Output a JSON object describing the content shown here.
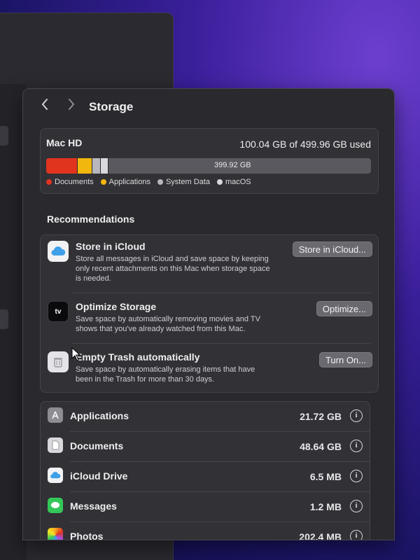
{
  "window": {
    "title": "Storage"
  },
  "disk": {
    "name": "Mac HD",
    "used_text": "100.04 GB of 499.96 GB used",
    "free_label": "399.92 GB",
    "segments": [
      {
        "name": "Documents",
        "color": "#e0341f",
        "fraction": 0.097
      },
      {
        "name": "Applications",
        "color": "#f1b70d",
        "fraction": 0.046
      },
      {
        "name": "System Data",
        "color": "#b8b7bc",
        "fraction": 0.025
      },
      {
        "name": "macOS",
        "color": "#d9d8dc",
        "fraction": 0.023
      }
    ],
    "legend": [
      "Documents",
      "Applications",
      "System Data",
      "macOS"
    ]
  },
  "recommendations": {
    "title": "Recommendations",
    "items": [
      {
        "title": "Store in iCloud",
        "desc": "Store all messages in iCloud and save space by keeping only recent attachments on this Mac when storage space is needed.",
        "button": "Store in iCloud...",
        "icon": "icloud-icon"
      },
      {
        "title": "Optimize Storage",
        "desc": "Save space by automatically removing movies and TV shows that you've already watched from this Mac.",
        "button": "Optimize...",
        "icon": "apple-tv-icon",
        "icon_text": "tv"
      },
      {
        "title": "Empty Trash automatically",
        "desc": "Save space by automatically erasing items that have been in the Trash for more than 30 days.",
        "button": "Turn On...",
        "icon": "trash-icon"
      }
    ]
  },
  "categories": [
    {
      "name": "Applications",
      "size": "21.72 GB",
      "icon": "applications-icon",
      "color": "#8e8d93"
    },
    {
      "name": "Documents",
      "size": "48.64 GB",
      "icon": "documents-icon",
      "color": "#d9d8dc"
    },
    {
      "name": "iCloud Drive",
      "size": "6.5 MB",
      "icon": "icloud-drive-icon",
      "color": "#3ea0e8"
    },
    {
      "name": "Messages",
      "size": "1.2 MB",
      "icon": "messages-icon",
      "color": "#34c759"
    },
    {
      "name": "Photos",
      "size": "202.4 MB",
      "icon": "photos-icon",
      "color": "#f5a623"
    }
  ],
  "info_glyph": "i"
}
